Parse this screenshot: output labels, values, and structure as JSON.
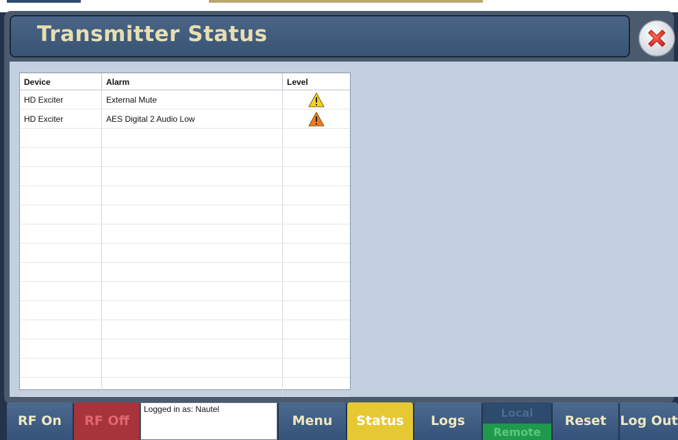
{
  "header": {
    "title": "Transmitter Status"
  },
  "alarm_table": {
    "columns": {
      "device": "Device",
      "alarm": "Alarm",
      "level": "Level"
    },
    "rows": [
      {
        "device": "HD Exciter",
        "alarm": "External Mute",
        "level_icon": "warning-icon",
        "level_color": "#f2d21e"
      },
      {
        "device": "HD Exciter",
        "alarm": "AES Digital 2 Audio Low",
        "level_icon": "warning-icon",
        "level_color": "#f07a1e"
      },
      {
        "device": "",
        "alarm": ""
      },
      {
        "device": "",
        "alarm": ""
      },
      {
        "device": "",
        "alarm": ""
      },
      {
        "device": "",
        "alarm": ""
      },
      {
        "device": "",
        "alarm": ""
      },
      {
        "device": "",
        "alarm": ""
      },
      {
        "device": "",
        "alarm": ""
      },
      {
        "device": "",
        "alarm": ""
      },
      {
        "device": "",
        "alarm": ""
      },
      {
        "device": "",
        "alarm": ""
      },
      {
        "device": "",
        "alarm": ""
      },
      {
        "device": "",
        "alarm": ""
      },
      {
        "device": "",
        "alarm": ""
      },
      {
        "device": "",
        "alarm": ""
      }
    ]
  },
  "footer": {
    "rf_on": "RF On",
    "rf_off": "RF Off",
    "login_status": "Logged in as: Nautel",
    "menu": "Menu",
    "status": "Status",
    "logs": "Logs",
    "local": "Local",
    "remote": "Remote",
    "reset": "Reset",
    "logout": "Log Out"
  },
  "colors": {
    "title_text": "#e8deb0",
    "active_button": "#e6c832",
    "rf_off_button": "#a7343a",
    "remote_active": "#1f9a4c"
  }
}
